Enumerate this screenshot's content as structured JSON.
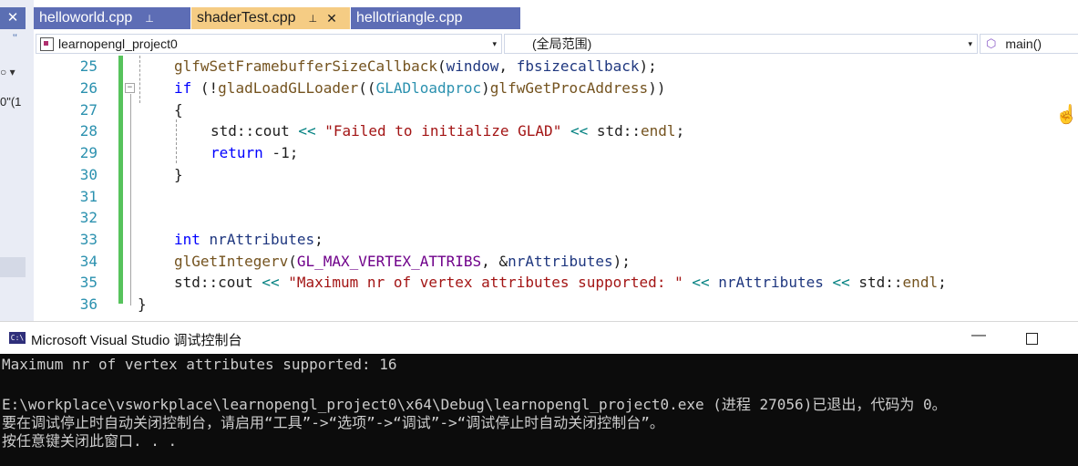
{
  "left_panel": {
    "close": "✕",
    "marks": "‛‛",
    "dropdown": "○ ▾",
    "fragment": "0\"(1"
  },
  "tabs": [
    {
      "label": "helloworld.cpp",
      "pin": "⊥",
      "active": false
    },
    {
      "label": "shaderTest.cpp",
      "pin": "⊥",
      "close": "✕",
      "active": true
    },
    {
      "label": "hellotriangle.cpp",
      "active": false
    }
  ],
  "nav": {
    "project": "learnopengl_project0",
    "scope": "(全局范围)",
    "member": "main()",
    "caret": "▾"
  },
  "editor": {
    "line_numbers": [
      "25",
      "26",
      "27",
      "28",
      "29",
      "30",
      "31",
      "32",
      "33",
      "34",
      "35",
      "36"
    ],
    "fold_marker": "−"
  },
  "code": {
    "l25": {
      "fn": "glfwSetFramebufferSizeCallback",
      "p1": "(",
      "var1": "window",
      "p2": ", ",
      "fn2": "fbsizecallback",
      "p3": ");"
    },
    "l26": {
      "kw": "if",
      "p1": " (!",
      "fn": "gladLoadGLLoader",
      "p2": "((",
      "ty": "GLADloadproc",
      "p3": ")",
      "fn2": "glfwGetProcAddress",
      "p4": "))"
    },
    "l27": {
      "text": "{"
    },
    "l28": {
      "ns": "std",
      "sep": "::",
      "id": "cout",
      "op": " << ",
      "str": "\"Failed to initialize GLAD\"",
      "op2": " << ",
      "ns2": "std",
      "sep2": "::",
      "fn": "endl",
      "end": ";"
    },
    "l29": {
      "kw": "return",
      "rest": " -1;"
    },
    "l30": {
      "text": "}"
    },
    "l33": {
      "kw": "int",
      "sp": " ",
      "var": "nrAttributes",
      "end": ";"
    },
    "l34": {
      "fn": "glGetIntegerv",
      "p1": "(",
      "mac": "GL_MAX_VERTEX_ATTRIBS",
      "p2": ", &",
      "var": "nrAttributes",
      "p3": ");"
    },
    "l35": {
      "ns": "std",
      "sep": "::",
      "id": "cout",
      "op": " << ",
      "str": "\"Maximum nr of vertex attributes supported: \"",
      "op2": " << ",
      "var": "nrAttributes",
      "op3": " << ",
      "ns2": "std",
      "sep2": "::",
      "fn": "endl",
      "end": ";"
    },
    "l36": {
      "text": "}"
    }
  },
  "console": {
    "icon_text": "C:\\",
    "title": "Microsoft Visual Studio 调试控制台",
    "minimize": "—",
    "lines": [
      "Maximum nr of vertex attributes supported: 16",
      "",
      "E:\\workplace\\vsworkplace\\learnopengl_project0\\x64\\Debug\\learnopengl_project0.exe (进程 27056)已退出，代码为 0。",
      "要在调试停止时自动关闭控制台，请启用“工具”->“选项”->“调试”->“调试停止时自动关闭控制台”。",
      "按任意键关闭此窗口. . ."
    ]
  },
  "colors": {
    "tab_bg": "#5d6db5",
    "tab_active_bg": "#f5cc84",
    "change_bar": "#57c35c",
    "line_number": "#2b91af",
    "console_bg": "#0c0c0c"
  }
}
